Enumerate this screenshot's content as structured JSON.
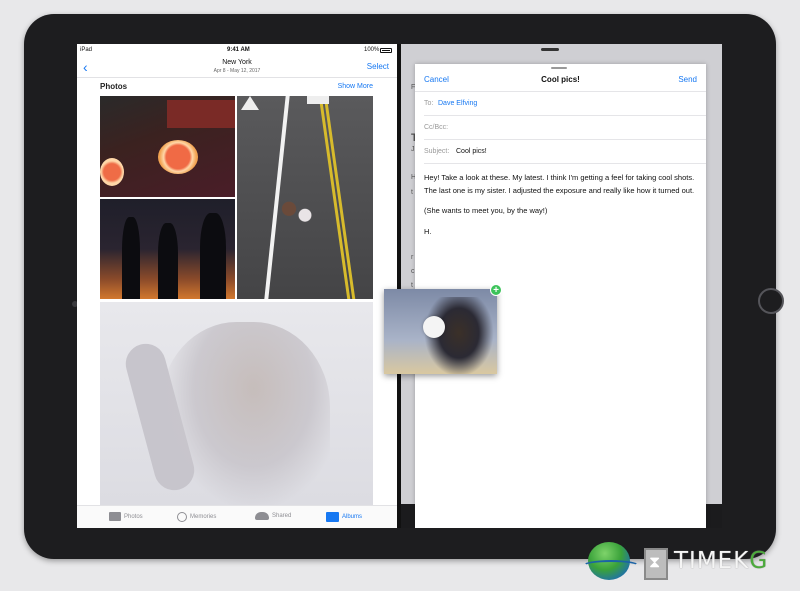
{
  "status_bar": {
    "device": "iPad",
    "time": "9:41 AM",
    "battery": "100%"
  },
  "photos_app": {
    "nav": {
      "title": "New York",
      "subtitle": "Apr 8 - May 12, 2017",
      "select_label": "Select"
    },
    "section": {
      "title": "Photos",
      "show_more": "Show More"
    },
    "tabs": [
      {
        "label": "Photos",
        "icon": "photos-icon"
      },
      {
        "label": "Memories",
        "icon": "memories-icon"
      },
      {
        "label": "Shared",
        "icon": "cloud-icon"
      },
      {
        "label": "Albums",
        "icon": "albums-icon",
        "selected": true
      }
    ]
  },
  "mail_compose": {
    "cancel_label": "Cancel",
    "title": "Cool pics!",
    "send_label": "Send",
    "to_label": "To:",
    "to_value": "Dave Elfving",
    "cc_label": "Cc/Bcc:",
    "subject_label": "Subject:",
    "subject_value": "Cool pics!",
    "body": [
      "Hey! Take a look at these. My latest. I think I'm getting a feel for taking cool shots. The last one is my sister. I adjusted the exposure and really like how it turned out.",
      "(She wants to meet you, by the way!)",
      "H."
    ]
  },
  "background_mail": {
    "ghost_letters": [
      "F",
      "T",
      "J",
      "H",
      "t",
      "r",
      "c",
      "t"
    ]
  },
  "drag": {
    "badge": "+"
  },
  "watermark": {
    "text_a": "TIME",
    "text_b": "K",
    "text_c": "G"
  },
  "colors": {
    "accent": "#1778f2",
    "badge_green": "#3cc35a"
  }
}
